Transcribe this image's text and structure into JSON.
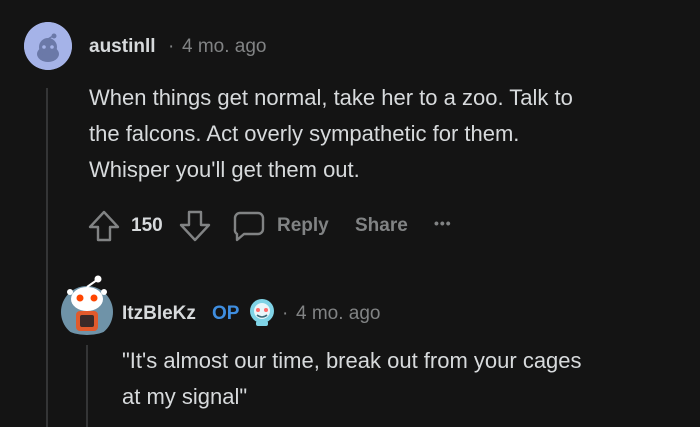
{
  "comments": [
    {
      "username": "austinll",
      "separator": "·",
      "time": "4 mo. ago",
      "body_lines": [
        "When things get normal, take her to a zoo. Talk to",
        "the falcons. Act overly sympathetic for them.",
        "Whisper you'll get them out."
      ],
      "votes": "150",
      "reply_label": "Reply",
      "share_label": "Share",
      "more_label": "•••"
    },
    {
      "username": "ItzBleKz",
      "op_label": "OP",
      "separator": "·",
      "time": "4 mo. ago",
      "body_lines": [
        "\"It's almost our time, break out from your cages",
        "at my signal\""
      ]
    }
  ],
  "colors": {
    "background": "#141414",
    "text": "#d7dadc",
    "muted": "#818384",
    "op": "#3f8ee0",
    "avatar1_bg": "#a5b3e8"
  }
}
